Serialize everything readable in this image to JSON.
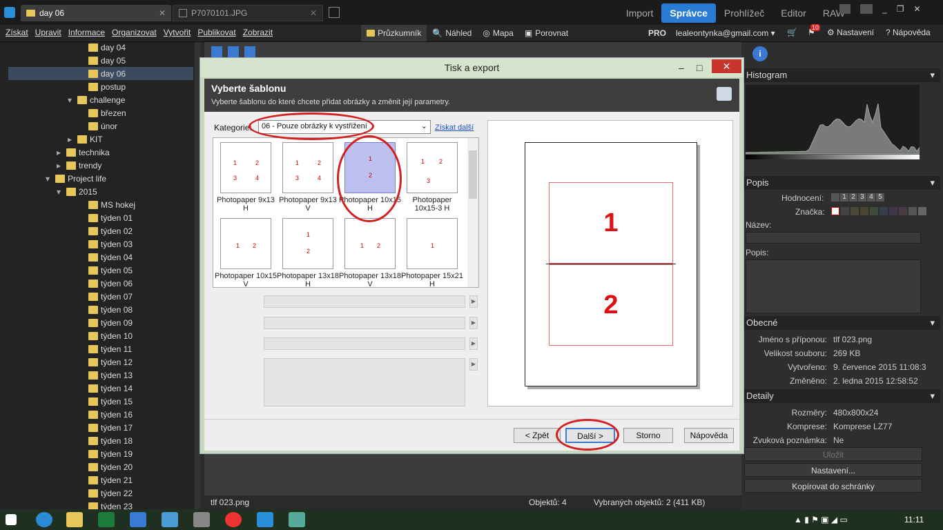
{
  "titlebar": {
    "tabs": [
      {
        "label": "day 06"
      },
      {
        "label": "P7070101.JPG"
      }
    ],
    "modes": [
      "Import",
      "Správce",
      "Prohlížeč",
      "Editor",
      "RAW"
    ]
  },
  "menubar": {
    "menus": [
      "Získat",
      "Upravit",
      "Informace",
      "Organizovat",
      "Vytvořit",
      "Publikovat",
      "Zobrazit"
    ],
    "views": [
      "Průzkumník",
      "Náhled",
      "Mapa",
      "Porovnat"
    ],
    "pro": "PRO",
    "account": "lealeontynka@gmail.com",
    "cart_badge": "10",
    "settings": "Nastavení",
    "help": "Nápověda"
  },
  "sidebar": {
    "rows": [
      {
        "label": "day 04",
        "indent": 128
      },
      {
        "label": "day 05",
        "indent": 128
      },
      {
        "label": "day 06",
        "indent": 128,
        "selected": true
      },
      {
        "label": "postup",
        "indent": 128
      },
      {
        "label": "challenge",
        "indent": 112,
        "expanded": true
      },
      {
        "label": "březen",
        "indent": 128
      },
      {
        "label": "únor",
        "indent": 128
      },
      {
        "label": "KIT",
        "indent": 112,
        "collapsed": true
      },
      {
        "label": "technika",
        "indent": 96,
        "collapsed": true
      },
      {
        "label": "trendy",
        "indent": 96,
        "collapsed": true
      },
      {
        "label": "Project life",
        "indent": 80,
        "expanded": true
      },
      {
        "label": "2015",
        "indent": 96,
        "expanded": true
      },
      {
        "label": "MS hokej",
        "indent": 128
      },
      {
        "label": "týden 01",
        "indent": 128
      },
      {
        "label": "týden 02",
        "indent": 128
      },
      {
        "label": "týden 03",
        "indent": 128
      },
      {
        "label": "týden 04",
        "indent": 128
      },
      {
        "label": "týden 05",
        "indent": 128
      },
      {
        "label": "týden 06",
        "indent": 128
      },
      {
        "label": "týden 07",
        "indent": 128
      },
      {
        "label": "týden 08",
        "indent": 128
      },
      {
        "label": "týden 09",
        "indent": 128
      },
      {
        "label": "týden 10",
        "indent": 128
      },
      {
        "label": "týden 11",
        "indent": 128
      },
      {
        "label": "týden 12",
        "indent": 128
      },
      {
        "label": "týden 13",
        "indent": 128
      },
      {
        "label": "týden 14",
        "indent": 128
      },
      {
        "label": "týden 15",
        "indent": 128
      },
      {
        "label": "týden 16",
        "indent": 128
      },
      {
        "label": "týden 17",
        "indent": 128
      },
      {
        "label": "týden 18",
        "indent": 128
      },
      {
        "label": "týden 19",
        "indent": 128
      },
      {
        "label": "týden 20",
        "indent": 128
      },
      {
        "label": "týden 21",
        "indent": 128
      },
      {
        "label": "týden 22",
        "indent": 128
      },
      {
        "label": "týden 23",
        "indent": 128
      }
    ]
  },
  "dialog": {
    "title": "Tisk a export",
    "heading": "Vyberte šablonu",
    "subheading": "Vyberte šablonu do které chcete přidat obrázky a změnit její parametry.",
    "category_label": "Kategorie:",
    "category_value": "06 - Pouze obrázky k vystřižení",
    "get_more": "Získat další",
    "templates": [
      {
        "label": "Photopaper 9x13 H",
        "cells": [
          "1",
          "2",
          "3",
          "4"
        ]
      },
      {
        "label": "Photopaper 9x13 V",
        "cells": [
          "1",
          "2",
          "3",
          "4"
        ]
      },
      {
        "label": "Photopaper 10x15 H",
        "cells": [
          "1",
          "2"
        ],
        "selected": true
      },
      {
        "label": "Photopaper 10x15-3 H",
        "cells": [
          "1",
          "2",
          "3"
        ]
      },
      {
        "label": "Photopaper 10x15 V",
        "cells": [
          "1",
          "2"
        ]
      },
      {
        "label": "Photopaper 13x18 H",
        "cells": [
          "1",
          "2"
        ]
      },
      {
        "label": "Photopaper 13x18 V",
        "cells": [
          "1",
          "2"
        ]
      },
      {
        "label": "Photopaper 15x21 H",
        "cells": [
          "1"
        ]
      }
    ],
    "preview": {
      "cell1": "1",
      "cell2": "2"
    },
    "buttons": {
      "back": "< Zpět",
      "next": "Další >",
      "cancel": "Storno",
      "help": "Nápověda"
    }
  },
  "rightpanel": {
    "histogram": "Histogram",
    "popis": "Popis",
    "hodnoceni_label": "Hodnocení:",
    "hodnoceni_values": [
      "1",
      "2",
      "3",
      "4",
      "5"
    ],
    "znacka_label": "Značka:",
    "nazev_label": "Název:",
    "popis_label": "Popis:",
    "obecne": "Obecné",
    "props": [
      {
        "k": "Jméno s příponou:",
        "v": "tlf 023.png"
      },
      {
        "k": "Velikost souboru:",
        "v": "269 KB"
      },
      {
        "k": "Vytvořeno:",
        "v": "9. července 2015 11:08:3"
      },
      {
        "k": "Změněno:",
        "v": "2. ledna 2015 12:58:52"
      }
    ],
    "detaily": "Detaily",
    "details": [
      {
        "k": "Rozměry:",
        "v": "480x800x24"
      },
      {
        "k": "Komprese:",
        "v": "Komprese LZ77"
      },
      {
        "k": "Zvuková poznámka:",
        "v": "Ne"
      }
    ],
    "btn_save": "Uložit",
    "btn_settings": "Nastavení...",
    "btn_copy": "Kopírovat do schránky"
  },
  "statusbar": {
    "file": "tlf 023.png",
    "objects": "Objektů: 4",
    "selected": "Vybraných objektů: 2 (411 KB)"
  },
  "taskbar": {
    "time": "11:11"
  }
}
